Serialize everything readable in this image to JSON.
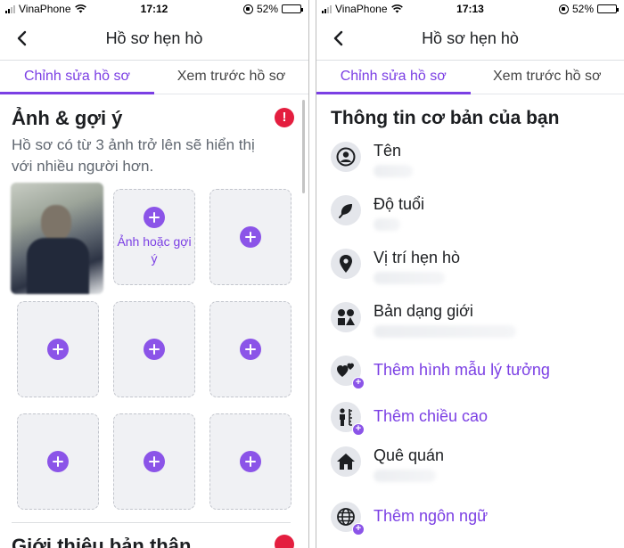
{
  "left": {
    "status": {
      "carrier": "VinaPhone",
      "time": "17:12",
      "battery": "52%",
      "battery_level": 0.52
    },
    "header": {
      "title": "Hồ sơ hẹn hò"
    },
    "tabs": [
      {
        "label": "Chỉnh sửa hồ sơ",
        "active": true
      },
      {
        "label": "Xem trước hồ sơ",
        "active": false
      }
    ],
    "section": {
      "title": "Ảnh & gợi ý",
      "description": "Hồ sơ có từ 3 ảnh trở lên sẽ hiển thị với nhiều người hơn.",
      "slot_label": "Ảnh hoặc gợi ý"
    },
    "next_section_title": "Giới thiệu bản thân"
  },
  "right": {
    "status": {
      "carrier": "VinaPhone",
      "time": "17:13",
      "battery": "52%",
      "battery_level": 0.52
    },
    "header": {
      "title": "Hồ sơ hẹn hò"
    },
    "tabs": [
      {
        "label": "Chỉnh sửa hồ sơ",
        "active": true
      },
      {
        "label": "Xem trước hồ sơ",
        "active": false
      }
    ],
    "info_title": "Thông tin cơ bản của bạn",
    "rows": [
      {
        "label": "Tên",
        "icon": "person-icon"
      },
      {
        "label": "Độ tuổi",
        "icon": "leaf-icon"
      },
      {
        "label": "Vị trí hẹn hò",
        "icon": "location-pin-icon"
      },
      {
        "label": "Bản dạng giới",
        "icon": "shapes-icon"
      },
      {
        "label": "Thêm hình mẫu lý tưởng",
        "icon": "hearts-icon"
      },
      {
        "label": "Thêm chiều cao",
        "icon": "height-icon"
      },
      {
        "label": "Quê quán",
        "icon": "home-icon"
      },
      {
        "label": "Thêm ngôn ngữ",
        "icon": "globe-icon"
      }
    ]
  },
  "colors": {
    "accent": "#7b3fe4",
    "alert": "#e41e3f"
  }
}
